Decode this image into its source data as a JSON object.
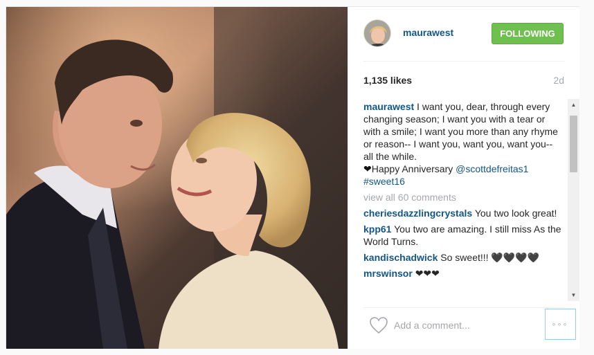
{
  "post": {
    "username": "maurawest",
    "follow_label": "FOLLOWING",
    "likes": "1,135 likes",
    "time_ago": "2d"
  },
  "caption": {
    "username": "maurawest",
    "text": " I want you, dear, through every changing season; I want you with a tear or with a smile; I want you more than any rhyme or reason-- I want you, want you, want you-- all the while.",
    "heart_glyph": "❤",
    "anniversary": "Happy Anniversary ",
    "mention": "@scottdefreitas1",
    "hashtag": "#sweet16"
  },
  "view_all": "view all 60 comments",
  "comments": [
    {
      "username": "cheriesdazzlingcrystals",
      "text": " You two look great!"
    },
    {
      "username": "kpp61",
      "text": " You two are amazing. I still miss As the World Turns."
    },
    {
      "username": "kandischadwick",
      "text": " So sweet!!! 🖤🖤🖤🖤"
    },
    {
      "username": "mrswinsor",
      "text": " ❤❤❤"
    }
  ],
  "comment_box": {
    "placeholder": "Add a comment...",
    "more_label": "◦◦◦"
  },
  "colors": {
    "follow_button": "#70c050",
    "username_link": "#125688",
    "muted_text": "#a5a7aa"
  },
  "icons": {
    "like": "heart-outline-icon",
    "more": "more-options-icon"
  }
}
